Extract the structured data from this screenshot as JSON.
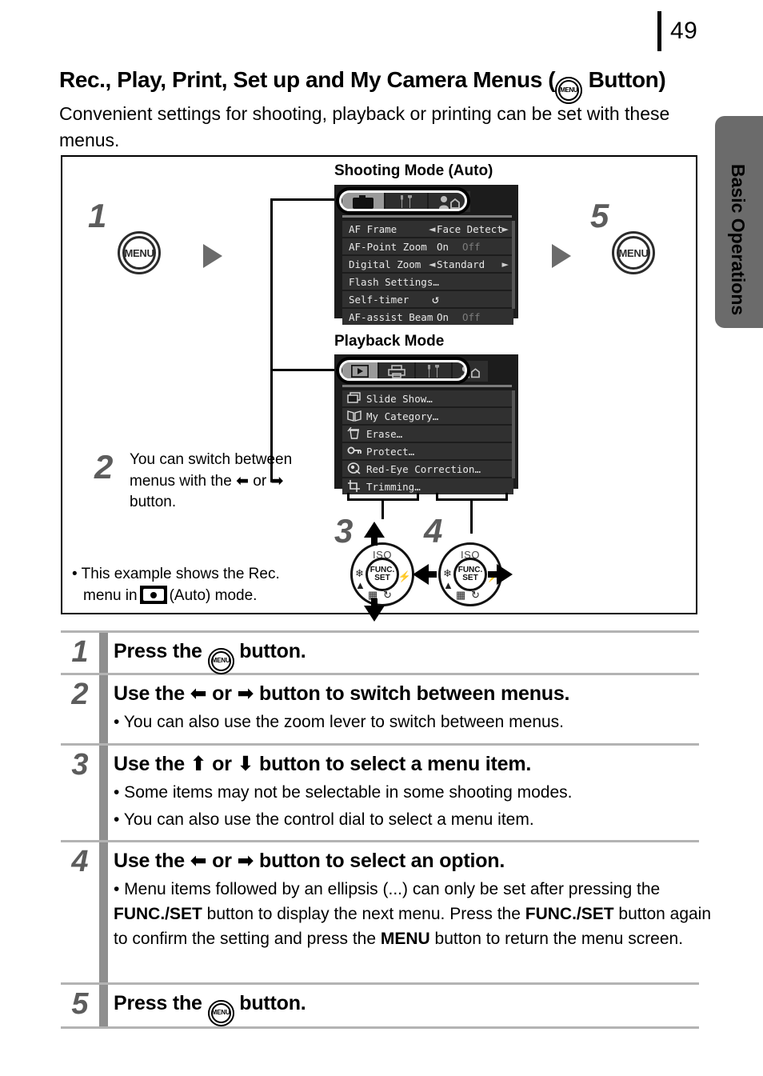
{
  "page": {
    "number": "49",
    "side_tab_label": "Basic Operations"
  },
  "heading": {
    "title_before": "Rec., Play, Print, Set up and My Camera Menus (",
    "title_after": " Button)",
    "menu_icon": "menu-button-icon",
    "menu_icon_label": "MENU",
    "subtitle": "Convenient settings for shooting, playback or printing can be set with these menus."
  },
  "figure": {
    "shooting_label": "Shooting Mode (Auto)",
    "playback_label": "Playback Mode",
    "step1": "1",
    "step2": "2",
    "step3": "3",
    "step4": "4",
    "step5": "5",
    "menu_button_label": "MENU",
    "step2_note": "You can switch between menus with the  ←  or → button.",
    "step2_note_a": "You can switch between",
    "step2_note_b": "menus with the",
    "step2_note_or": "or",
    "step2_note_c": "button.",
    "bottom_note_a": "• This example shows the Rec.",
    "bottom_note_b": "menu in",
    "bottom_note_c": "(Auto) mode.",
    "shooting_menu": {
      "tabs": [
        {
          "icon": "camera-icon",
          "selected": true
        },
        {
          "icon": "wrench-hammer-icon",
          "selected": false
        },
        {
          "icon": "my-camera-icon",
          "selected": false
        }
      ],
      "items": [
        {
          "name": "AF Frame",
          "value": "Face Detect",
          "arrows": true,
          "dim_value": ""
        },
        {
          "name": "AF-Point Zoom",
          "value": "On",
          "arrows": false,
          "dim_value": "Off"
        },
        {
          "name": "Digital Zoom",
          "value": "Standard",
          "arrows": true,
          "dim_value": ""
        },
        {
          "name": "Flash Settings…",
          "value": "",
          "arrows": false,
          "dim_value": ""
        },
        {
          "name": "Self-timer",
          "value": "↺",
          "arrows": false,
          "dim_value": ""
        },
        {
          "name": "AF-assist Beam",
          "value": "On",
          "arrows": false,
          "dim_value": "Off"
        }
      ]
    },
    "playback_menu": {
      "tabs": [
        {
          "icon": "play-icon",
          "selected": true
        },
        {
          "icon": "print-icon",
          "selected": false
        },
        {
          "icon": "wrench-hammer-icon",
          "selected": false
        },
        {
          "icon": "my-camera-icon",
          "selected": false
        }
      ],
      "items": [
        {
          "icon": "slideshow-icon",
          "name": "Slide Show…"
        },
        {
          "icon": "category-icon",
          "name": "My Category…"
        },
        {
          "icon": "trash-icon",
          "name": "Erase…"
        },
        {
          "icon": "key-icon",
          "name": "Protect…"
        },
        {
          "icon": "redeye-icon",
          "name": "Red-Eye Correction…"
        },
        {
          "icon": "trimming-icon",
          "name": "Trimming…"
        }
      ]
    },
    "dial": {
      "iso_label": "ISO",
      "func_label_1": "FUNC.",
      "func_label_2": "SET",
      "macro_icon": "macro-flower-icon",
      "landscape_icon": "landscape-icon",
      "flash_icon": "flash-icon",
      "drive_icon": "continuous-drive-icon",
      "timer_icon": "self-timer-icon"
    }
  },
  "steps": [
    {
      "num": "1",
      "title_before": "Press the",
      "title_after": "button.",
      "has_menu_icon": true,
      "bullets": []
    },
    {
      "num": "2",
      "title_before": "Use the",
      "title_mid": "or",
      "title_after": "button to switch between menus.",
      "has_menu_icon": false,
      "arrows": "left-right",
      "bullets": [
        {
          "text": "• You can also use the zoom lever to switch between menus."
        }
      ]
    },
    {
      "num": "3",
      "title_before": "Use the",
      "title_mid": "or",
      "title_after": "button to select a menu item.",
      "has_menu_icon": false,
      "arrows": "up-down",
      "bullets": [
        {
          "text": "• Some items may not be selectable in some shooting modes."
        },
        {
          "text": "• You can also use the control dial to select a menu item."
        }
      ]
    },
    {
      "num": "4",
      "title_before": "Use the",
      "title_mid": "or",
      "title_after": "button to select an option.",
      "has_menu_icon": false,
      "arrows": "left-right",
      "bullets": [
        {
          "p1": "• Menu items followed by an ellipsis (...) can only be set after pressing the ",
          "b1": "FUNC./SET",
          "p2": " button to display the next menu. Press the ",
          "b2": "FUNC./SET",
          "p3": " button again to confirm the setting and press the ",
          "b3": "MENU",
          "p4": " button to return the menu screen."
        }
      ]
    },
    {
      "num": "5",
      "title_before": "Press the",
      "title_after": "button.",
      "has_menu_icon": true,
      "bullets": []
    }
  ]
}
